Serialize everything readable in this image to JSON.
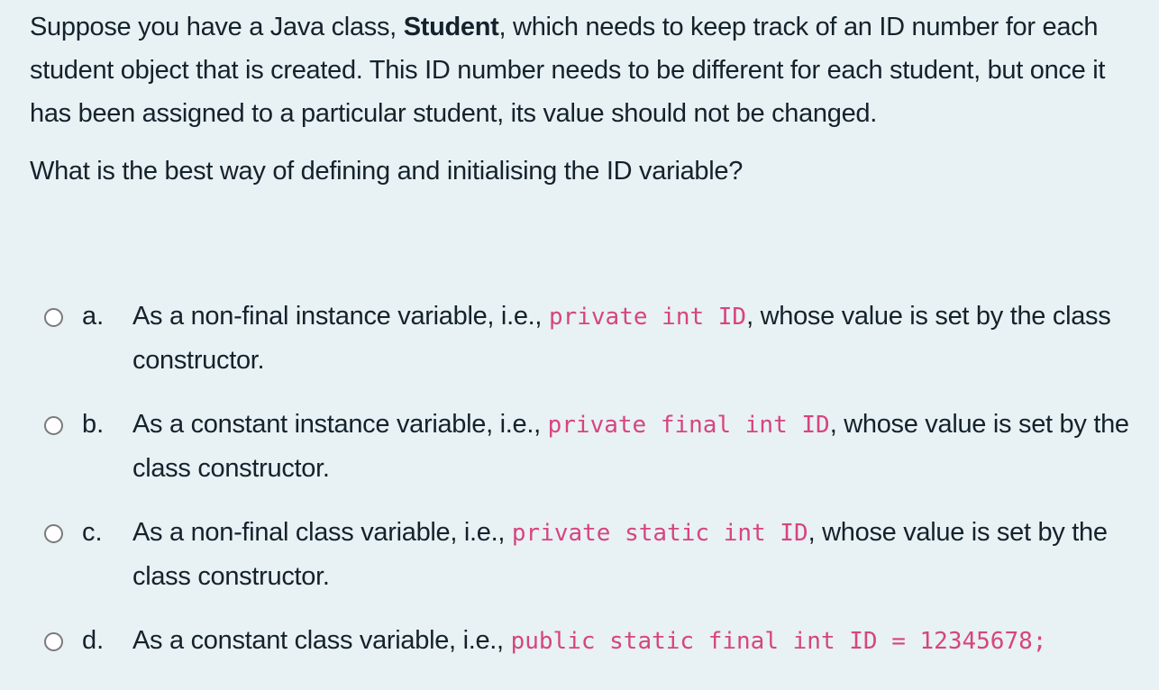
{
  "question": {
    "intro_before_bold": "Suppose you have a Java class, ",
    "class_name": "Student",
    "intro_after_bold": ", which needs to keep track of an ID number for each student object that is created. This ID number needs to be different for each student, but once it has been assigned to a particular student, its value should not be changed.",
    "prompt": "What is the best way of defining and initialising the ID variable?"
  },
  "options": [
    {
      "letter": "a.",
      "before": "As a non-final instance variable, i.e., ",
      "code": "private int ID",
      "after": ", whose value is set by the class constructor.",
      "selected": false
    },
    {
      "letter": "b.",
      "before": "As a constant instance variable, i.e., ",
      "code": "private final int ID",
      "after": ", whose value is set by the class constructor.",
      "selected": false
    },
    {
      "letter": "c.",
      "before": "As a non-final class variable, i.e., ",
      "code": "private static int ID",
      "after": ", whose value is set by the class constructor.",
      "selected": false
    },
    {
      "letter": "d.",
      "before": "As a constant class variable, i.e., ",
      "code": "public static final int ID = 12345678;",
      "after": "",
      "selected": false
    }
  ],
  "colors": {
    "background": "#e8f1f4",
    "code": "#d6457f",
    "text": "#14222b"
  }
}
